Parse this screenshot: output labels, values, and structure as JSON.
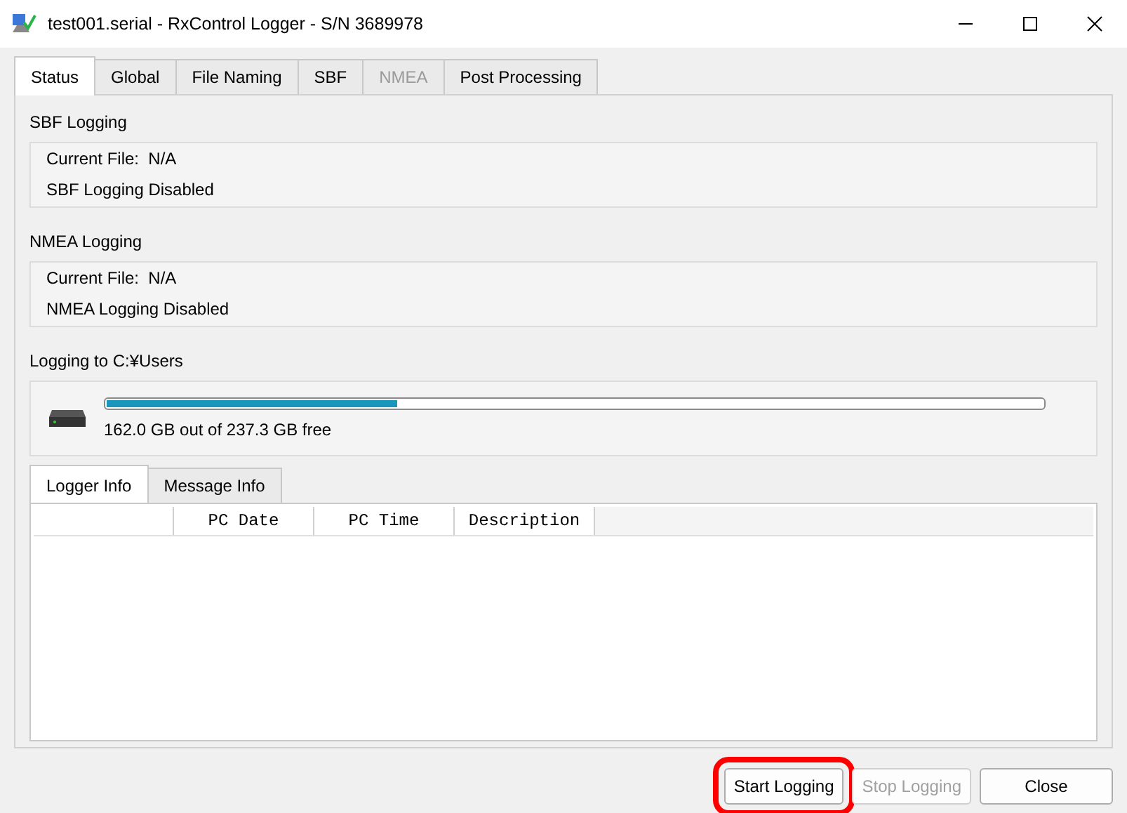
{
  "window": {
    "title": "test001.serial - RxControl Logger - S/N 3689978"
  },
  "tabs": [
    {
      "label": "Status",
      "selected": true,
      "disabled": false
    },
    {
      "label": "Global",
      "selected": false,
      "disabled": false
    },
    {
      "label": "File Naming",
      "selected": false,
      "disabled": false
    },
    {
      "label": "SBF",
      "selected": false,
      "disabled": false
    },
    {
      "label": "NMEA",
      "selected": false,
      "disabled": true
    },
    {
      "label": "Post Processing",
      "selected": false,
      "disabled": false
    }
  ],
  "groups": [
    {
      "title": "SBF Logging",
      "lines": [
        {
          "label": "Current File:",
          "value": "N/A"
        },
        {
          "label": "SBF Logging Disabled"
        }
      ]
    },
    {
      "title": "NMEA Logging",
      "lines": [
        {
          "label": "Current File:",
          "value": "N/A"
        },
        {
          "label": "NMEA Logging Disabled"
        }
      ]
    }
  ],
  "disk": {
    "title": "Logging to C:¥Users",
    "level": 0.31,
    "free_text": "162.0 GB out of 237.3 GB free"
  },
  "info_tabs": [
    {
      "label": "Logger Info",
      "selected": true
    },
    {
      "label": "Message Info",
      "selected": false
    }
  ],
  "table": {
    "columns": [
      "PC Date",
      "PC Time",
      "Description"
    ]
  },
  "buttons": [
    {
      "label": "Start Logging",
      "disabled": false,
      "highlighted": true
    },
    {
      "label": "Stop Logging",
      "disabled": true,
      "highlighted": false
    },
    {
      "label": "Close",
      "disabled": false,
      "highlighted": false
    }
  ]
}
